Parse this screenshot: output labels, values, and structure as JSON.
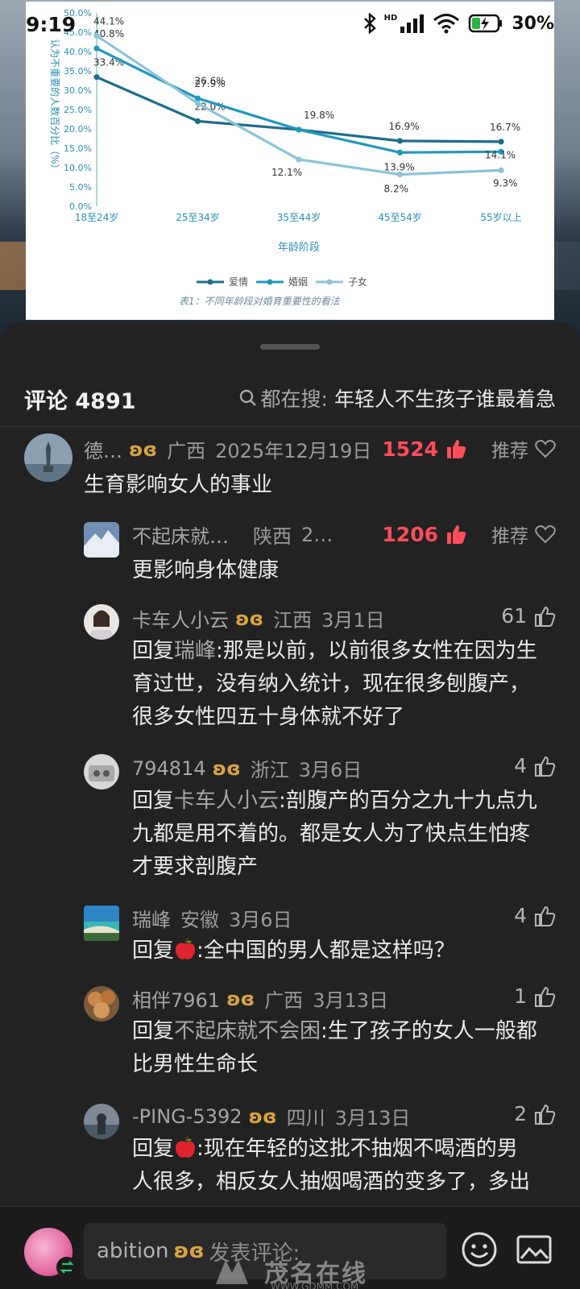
{
  "status_bar": {
    "time": "9:19",
    "hd_label": "HD",
    "battery": "30%"
  },
  "chart_data": {
    "type": "line",
    "caption": "表1：不同年龄段对婚育重要性的看法",
    "xlabel": "年龄阶段",
    "ylabel": "认为不重要的人数百分比（%）",
    "categories": [
      "18至24岁",
      "25至34岁",
      "35至44岁",
      "45至54岁",
      "55岁以上"
    ],
    "ylim": [
      0,
      50
    ],
    "yticks": [
      "0.0%",
      "5.0%",
      "10.0%",
      "15.0%",
      "20.0%",
      "25.0%",
      "30.0%",
      "35.0%",
      "40.0%",
      "45.0%",
      "50.0%"
    ],
    "legend_position": "bottom",
    "series": [
      {
        "name": "爱情",
        "color": "#1b6e8a",
        "values": [
          33.4,
          22.0,
          19.8,
          16.9,
          16.7
        ],
        "labels": [
          "33.4%",
          "22.0%",
          "19.8%",
          "16.9%",
          "16.7%"
        ]
      },
      {
        "name": "婚姻",
        "color": "#1f98bd",
        "values": [
          40.8,
          27.9,
          19.8,
          13.9,
          14.1
        ],
        "labels": [
          "40.8%",
          "27.9%",
          "",
          "13.9%",
          "14.1%"
        ]
      },
      {
        "name": "子女",
        "color": "#8cc4d8",
        "values": [
          44.1,
          26.6,
          12.1,
          8.2,
          9.3
        ],
        "labels": [
          "44.1%",
          "26.6%",
          "12.1%",
          "8.2%",
          "9.3%"
        ]
      }
    ]
  },
  "header": {
    "comments_label": "评论 4891",
    "search_prefix": "都在搜:",
    "search_query": "年轻人不生孩子谁最着急"
  },
  "comments": [
    {
      "name": "德…",
      "badge": "ʚɞ",
      "location": "广西",
      "date": "2025年12月19日",
      "likes": "1524",
      "recommend": "推荐",
      "text": "生育影响女人的事业"
    },
    {
      "name": "不起床就…",
      "location": "陕西",
      "date": "2…",
      "likes": "1206",
      "recommend": "推荐",
      "text": "更影响身体健康"
    },
    {
      "name": "卡车人小云",
      "badge": "ʚɞ",
      "location": "江西",
      "date": "3月1日",
      "likes": "61",
      "reply_prefix": "回复",
      "reply_to": "瑞峰",
      "text_lines": [
        ":那是以前，以前很多女性在因为生",
        "育过世，没有纳入统计，现在很多刨腹产，",
        "很多女性四五十身体就不好了"
      ]
    },
    {
      "name": "794814",
      "badge": "ʚɞ",
      "location": "浙江",
      "date": "3月6日",
      "likes": "4",
      "reply_prefix": "回复",
      "reply_to": "卡车人小云",
      "text_lines": [
        ":剖腹产的百分之九十九点九",
        "九都是用不着的。都是女人为了快点生怕疼",
        "才要求剖腹产"
      ]
    },
    {
      "name": "瑞峰",
      "location": "安徽",
      "date": "3月6日",
      "likes": "4",
      "reply_prefix": "回复",
      "text": ":全中国的男人都是这样吗？"
    },
    {
      "name": "相伴7961",
      "badge": "ʚɞ",
      "location": "广西",
      "date": "3月13日",
      "likes": "1",
      "reply_prefix": "回复",
      "reply_to": "不起床就不会困",
      "text_lines": [
        ":生了孩子的女人一般都",
        "比男性生命长"
      ]
    },
    {
      "name": "-PING-5392",
      "badge": "ʚɞ",
      "location": "四川",
      "date": "3月13日",
      "likes": "2",
      "reply_prefix": "回复",
      "text_lines": [
        ":现在年轻的这批不抽烟不喝酒的男",
        "人很多，相反女人抽烟喝酒的变多了，多出"
      ]
    }
  ],
  "input_bar": {
    "username": "abition",
    "badge": "ʚɞ",
    "placeholder": "发表评论:"
  },
  "watermark": {
    "text": "茂名在线",
    "url": "WWW.GDMM.COM"
  },
  "colors": {
    "hot_likes": "#ff4d5a",
    "badge": "#d9a441",
    "sheet_bg": "#222222"
  }
}
